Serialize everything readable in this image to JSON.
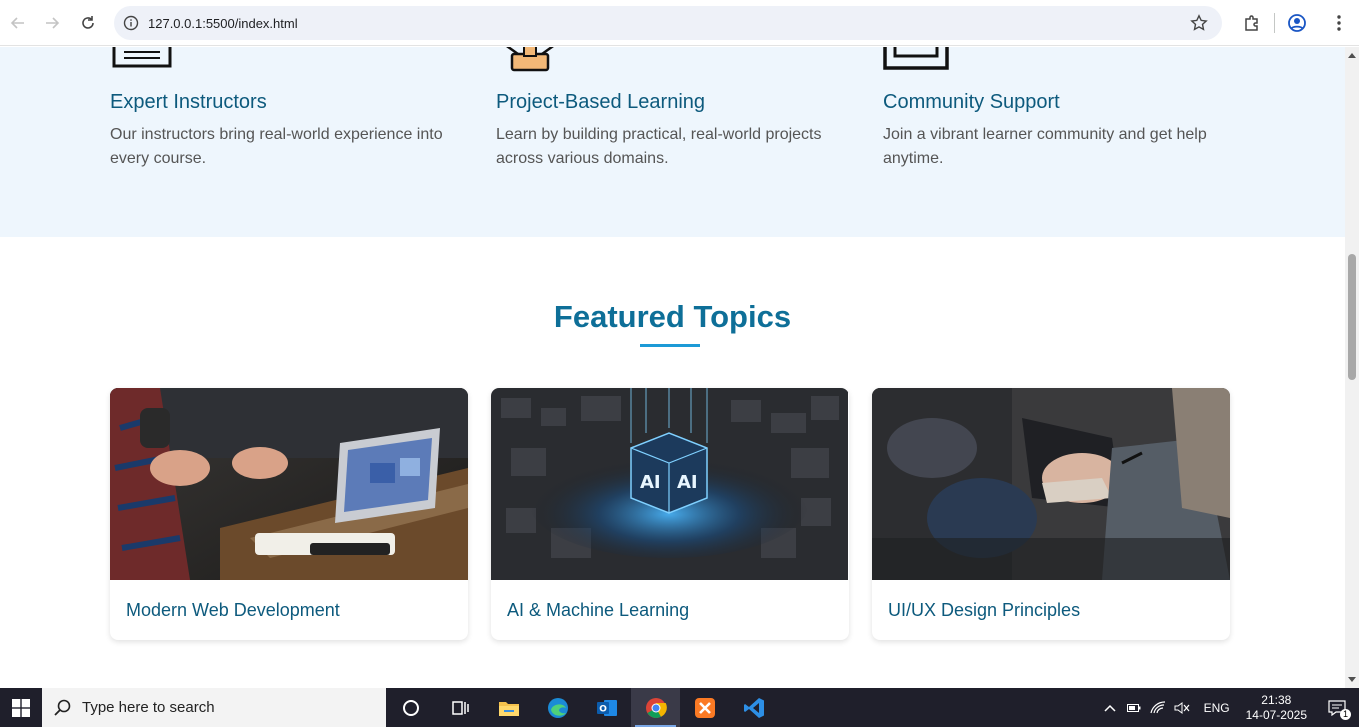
{
  "browser": {
    "url": "127.0.0.1:5500/index.html"
  },
  "features": [
    {
      "title": "Expert Instructors",
      "desc": "Our instructors bring real-world experience into every course."
    },
    {
      "title": "Project-Based Learning",
      "desc": "Learn by building practical, real-world projects across various domains."
    },
    {
      "title": "Community Support",
      "desc": "Join a vibrant learner community and get help anytime."
    }
  ],
  "featured": {
    "heading": "Featured Topics",
    "cards": [
      {
        "title": "Modern Web Development",
        "image": "laptop-meeting-photo"
      },
      {
        "title": "AI & Machine Learning",
        "image": "ai-chip-photo"
      },
      {
        "title": "UI/UX Design Principles",
        "image": "notes-audience-photo"
      }
    ]
  },
  "taskbar": {
    "search_placeholder": "Type here to search",
    "language": "ENG",
    "time": "21:38",
    "date": "14-07-2025",
    "notification_count": "1"
  },
  "colors": {
    "heading": "#0d5a7d",
    "accent": "#1c9ad6",
    "feature_bg": "#eef6fd"
  }
}
